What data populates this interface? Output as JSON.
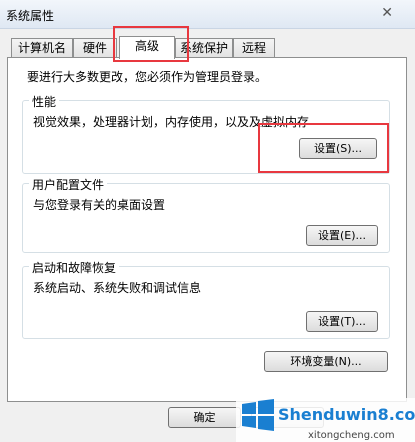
{
  "window": {
    "title": "系统属性",
    "close_symbol": "✕"
  },
  "tabs": [
    {
      "label": "计算机名"
    },
    {
      "label": "硬件"
    },
    {
      "label": "高级"
    },
    {
      "label": "系统保护"
    },
    {
      "label": "远程"
    }
  ],
  "admin_notice": "要进行大多数更改，您必须作为管理员登录。",
  "performance": {
    "title": "性能",
    "description": "视觉效果，处理器计划，内存使用，以及及虚拟内存",
    "button": "设置(S)..."
  },
  "user_profiles": {
    "title": "用户配置文件",
    "description": "与您登录有关的桌面设置",
    "button": "设置(E)..."
  },
  "startup_recovery": {
    "title": "启动和故障恢复",
    "description": "系统启动、系统失败和调试信息",
    "button": "设置(T)..."
  },
  "env_button": "环境变量(N)...",
  "footer": {
    "ok_button": "确定"
  },
  "watermark": {
    "brand": "Shenduwin8.com",
    "sub": "xitongcheng.com"
  },
  "colors": {
    "highlight": "#e8383f",
    "accent": "#1a7fd1"
  }
}
